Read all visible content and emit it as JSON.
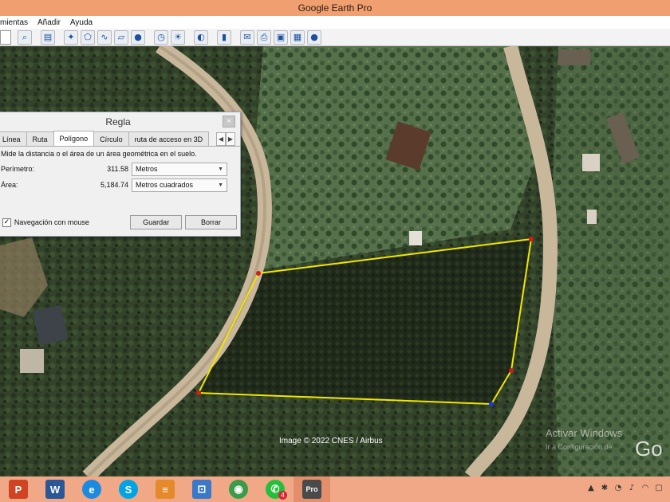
{
  "window": {
    "title": "Google Earth Pro"
  },
  "menu": {
    "items": [
      "mientas",
      "Añadir",
      "Ayuda"
    ]
  },
  "toolbar": {
    "buttons": [
      "search-icon",
      "sidebar-icon",
      "placemark-icon",
      "polygon-icon",
      "path-icon",
      "overlay-icon",
      "tour-icon",
      "historical-imagery-icon",
      "sun-icon",
      "planets-icon",
      "ruler-icon",
      "email-icon",
      "print-icon",
      "save-image-icon",
      "map-view-icon",
      "earth-icon"
    ]
  },
  "dialog": {
    "title": "Regla",
    "close": "×",
    "tabs": [
      "Línea",
      "Ruta",
      "Polígono",
      "Círculo",
      "ruta de acceso en 3D"
    ],
    "active_tab": "Polígono",
    "description": "Mide la distancia o el área de un área geométrica en el suelo.",
    "perimeter": {
      "label": "Perímetro:",
      "value": "311.58",
      "unit": "Metros"
    },
    "area": {
      "label": "Área:",
      "value": "5,184.74",
      "unit": "Metros cuadrados"
    },
    "mouse_nav": {
      "label": "Navegación con mouse",
      "checked": true
    },
    "save_label": "Guardar",
    "clear_label": "Borrar"
  },
  "map": {
    "attribution": "Image © 2022 CNES / Airbus",
    "watermark_line1": "Activar Windows",
    "watermark_line2": "Ir a Configuración de",
    "logo_text": "Go",
    "polygon_color": "#f2e600",
    "vertex_color": "#d21b1b"
  },
  "taskbar": {
    "apps": [
      {
        "name": "powerpoint",
        "glyph": "P",
        "color": "#d04423"
      },
      {
        "name": "word",
        "glyph": "W",
        "color": "#2b5797"
      },
      {
        "name": "edge",
        "glyph": "e",
        "color": "#1d8ae0"
      },
      {
        "name": "skype",
        "glyph": "S",
        "color": "#00a3e4"
      },
      {
        "name": "sublime",
        "glyph": "≡",
        "color": "#e58a2b"
      },
      {
        "name": "remote",
        "glyph": "⊡",
        "color": "#3a79c9"
      },
      {
        "name": "chrome",
        "glyph": "◉",
        "color": "#3c9b4b"
      },
      {
        "name": "whatsapp",
        "glyph": "✆",
        "color": "#25c03b",
        "badge": "4"
      },
      {
        "name": "google-earth-pro",
        "glyph": "Pro",
        "color": "#4a4a4a",
        "active": true
      }
    ]
  }
}
